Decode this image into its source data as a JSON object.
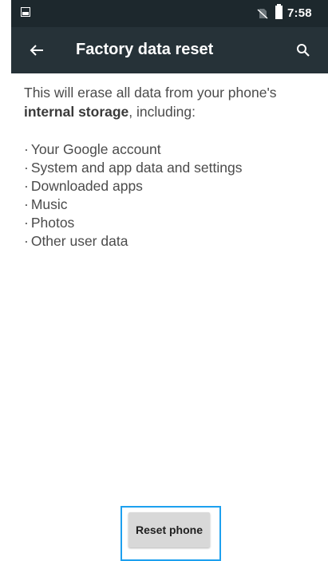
{
  "status_bar": {
    "time": "7:58",
    "icons": [
      "gallery-icon",
      "no-sim-icon",
      "battery-icon"
    ]
  },
  "app_bar": {
    "title": "Factory data reset",
    "back_icon": "arrow-left-icon",
    "search_icon": "search-icon",
    "background": "#263238"
  },
  "content": {
    "intro_prefix": "This will erase all data from your phone's ",
    "intro_bold": "internal storage",
    "intro_suffix": ", including:",
    "items": [
      "Your Google account",
      "System and app data and settings",
      "Downloaded apps",
      "Music",
      "Photos",
      "Other user data"
    ]
  },
  "actions": {
    "reset_label": "Reset phone",
    "highlight_color": "#1da0ef"
  }
}
